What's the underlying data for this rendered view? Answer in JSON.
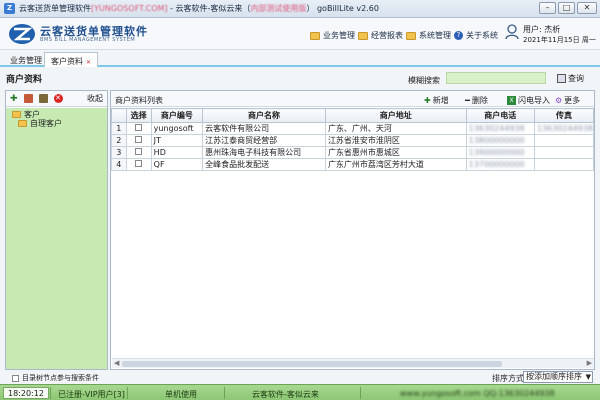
{
  "window": {
    "title_prefix": "云客送货单管理软件",
    "title_blur": "[YUNGOSOFT.COM]",
    "title_mid": " - 云客软件-客似云来（",
    "title_blur2": "内部测试使用版",
    "title_suffix": "）   goBillLite v2.60",
    "min": "–",
    "max": "□",
    "close": "✕"
  },
  "header": {
    "logo_main": "云客送货单管理软件",
    "logo_sub": "BMS BILL MANAGEMENT SYSTEM",
    "menu": [
      {
        "label": "业务管理"
      },
      {
        "label": "经营报表"
      },
      {
        "label": "系统管理"
      },
      {
        "label": "关于系统"
      }
    ],
    "user_name": "用户: 杰析",
    "user_date": "2021年11月15日 周一"
  },
  "nav": {
    "business": "业务管理",
    "active_tab": "客户资料",
    "close": "✕"
  },
  "page": {
    "title": "商户资料",
    "fuzzy_label": "模糊搜索",
    "fuzzy_value": "",
    "query": "查询"
  },
  "left": {
    "plus": "✚",
    "del": "✕",
    "collapse": "收起",
    "tree": [
      {
        "label": "客户"
      },
      {
        "label": "自理客户"
      }
    ],
    "checkbox_label": "目录树节点参与搜索条件"
  },
  "right": {
    "list_title": "商户资料列表",
    "add": "新增",
    "delete": "删除",
    "excel_import": "闪电导入",
    "more": "更多",
    "columns": [
      "",
      "选择",
      "商户编号",
      "商户名称",
      "商户地址",
      "商户电话",
      "传真"
    ],
    "rows": [
      {
        "num": "1",
        "code": "yungosoft",
        "name": "云客软件有限公司",
        "addr": "广东、广州、天河",
        "phone": "13630244938",
        "fax": "13630244938"
      },
      {
        "num": "2",
        "code": "JT",
        "name": "江苏江泰商贸经营部",
        "addr": "江苏省淮安市淮阴区",
        "phone": "13800000000",
        "fax": ""
      },
      {
        "num": "3",
        "code": "HD",
        "name": "惠州珠海电子科技有限公司",
        "addr": "广东省惠州市惠城区",
        "phone": "13900000000",
        "fax": ""
      },
      {
        "num": "4",
        "code": "QF",
        "name": "全峰食品批发配送",
        "addr": "广东广州市荔湾区芳村大道",
        "phone": "13700000000",
        "fax": ""
      }
    ],
    "sort_label": "排序方式:",
    "sort_value": "按添加顺序排序"
  },
  "status": {
    "time": "18:20:12",
    "reg": "已注册-VIP用户[3]",
    "mode": "单机使用",
    "brand": "云客软件-客似云来",
    "blur": "www.yungosoft.com   QQ:13630244938"
  }
}
